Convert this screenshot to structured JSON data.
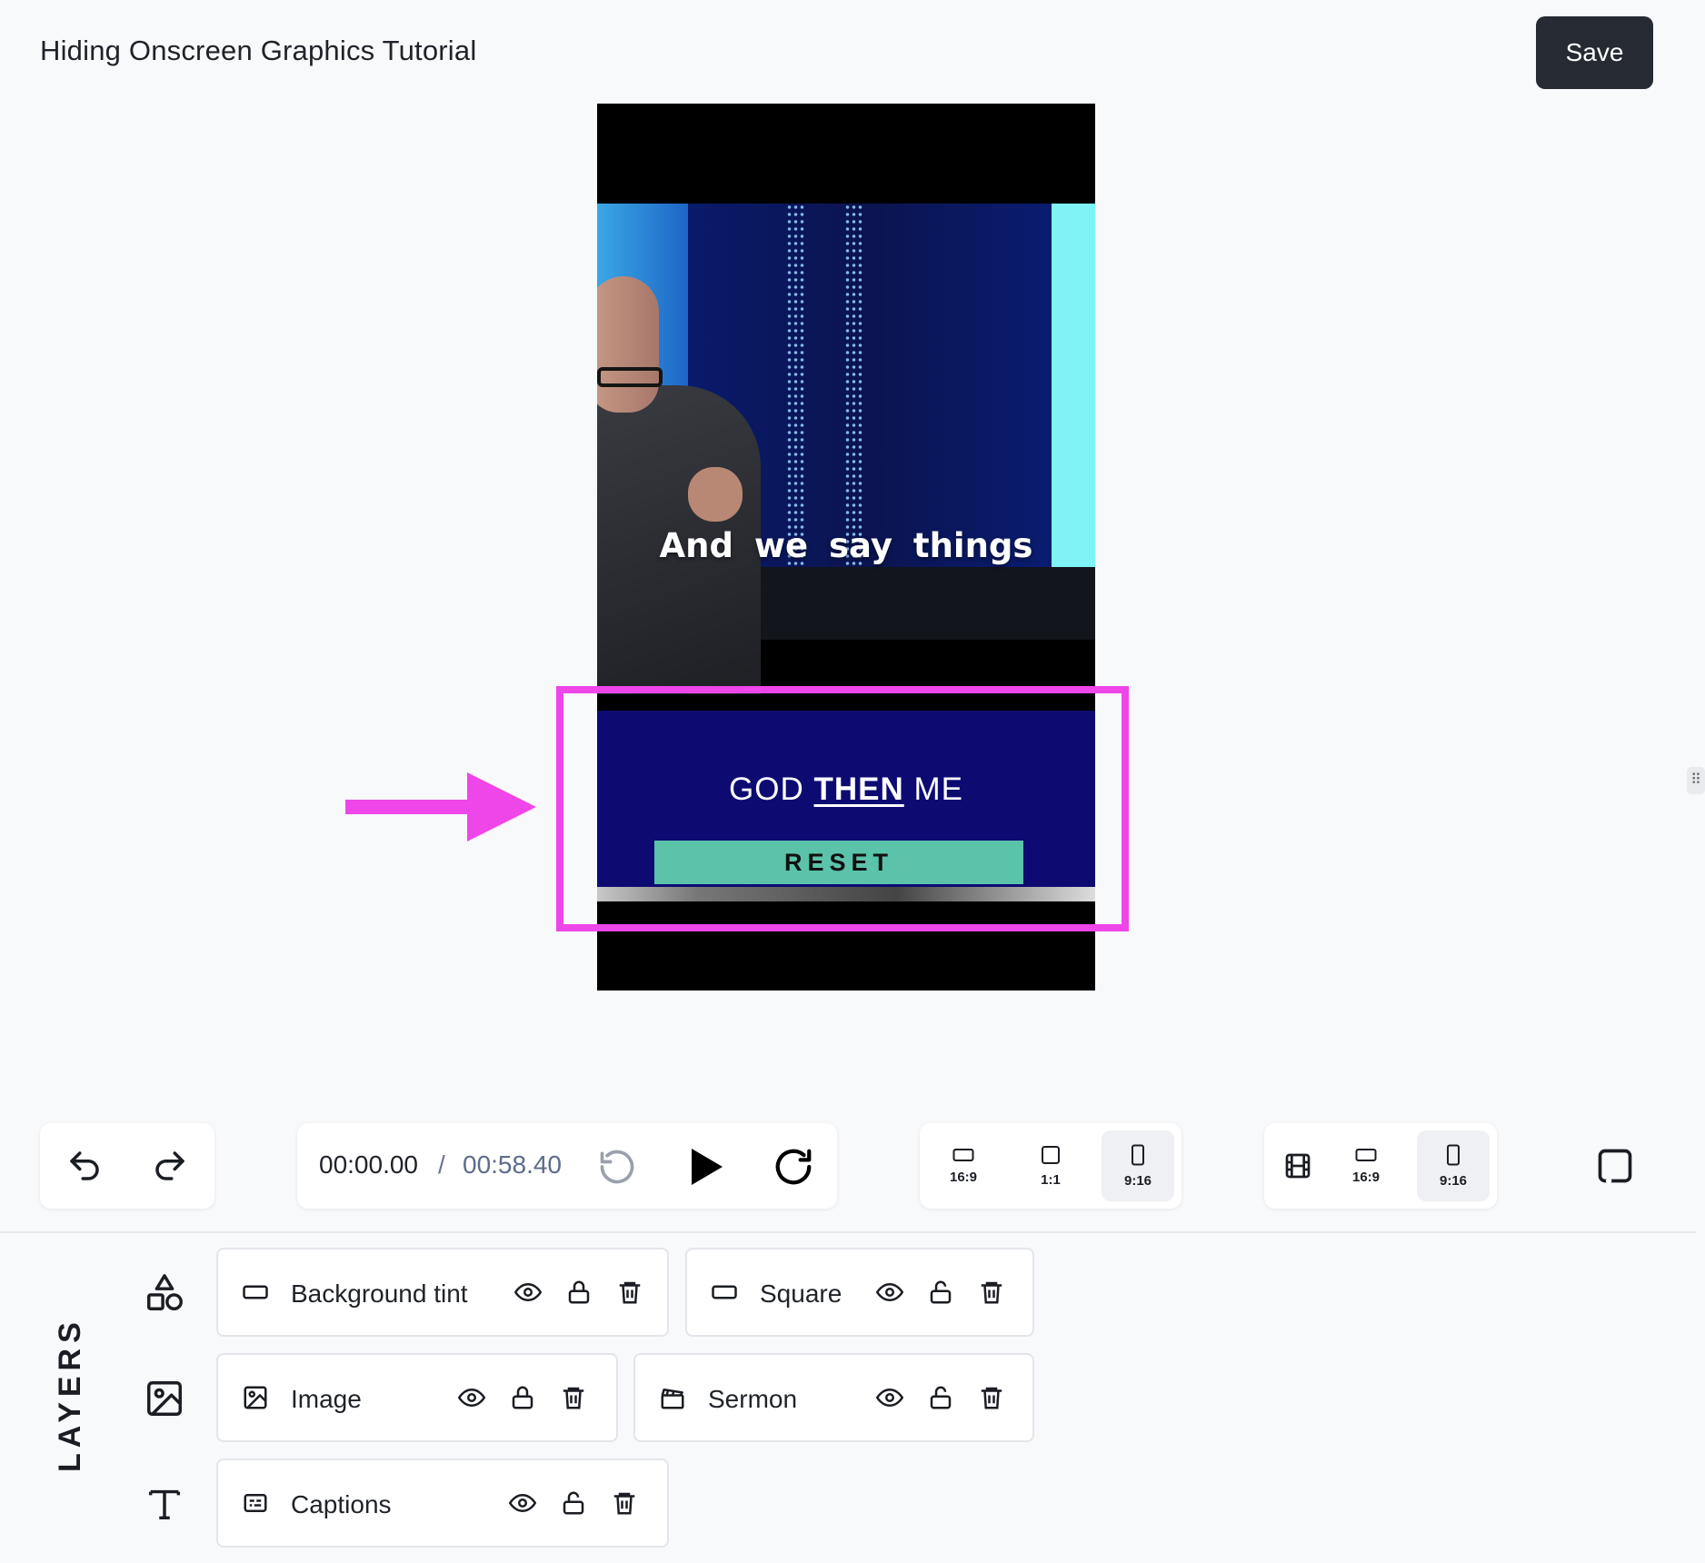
{
  "header": {
    "title": "Hiding Onscreen Graphics Tutorial",
    "save_label": "Save"
  },
  "preview": {
    "caption": "And we say things",
    "lower_third": {
      "title_part1": "GOD",
      "title_part2": "THEN",
      "title_part3": "ME",
      "badge": "RESET"
    },
    "colors": {
      "highlight": "#ee46e8",
      "lower_third_bg": "#0d0a72",
      "badge_bg": "#5bc3aa"
    }
  },
  "transport": {
    "current_time": "00:00.00",
    "separator": "/",
    "total_time": "00:58.40"
  },
  "aspect_ratios": {
    "options": [
      "16:9",
      "1:1",
      "9:16"
    ],
    "selected": "9:16"
  },
  "canvas_ratios": {
    "options": [
      "16:9",
      "9:16"
    ],
    "selected": "9:16"
  },
  "layers": {
    "heading": "LAYERS",
    "items": [
      {
        "name": "Background tint",
        "type": "rectangle-icon",
        "locked": true
      },
      {
        "name": "Square",
        "type": "rectangle-icon",
        "locked": false
      },
      {
        "name": "Image",
        "type": "image-icon",
        "locked": true
      },
      {
        "name": "Sermon",
        "type": "clapperboard-icon",
        "locked": false
      },
      {
        "name": "Captions",
        "type": "captions-icon",
        "locked": false
      }
    ]
  }
}
